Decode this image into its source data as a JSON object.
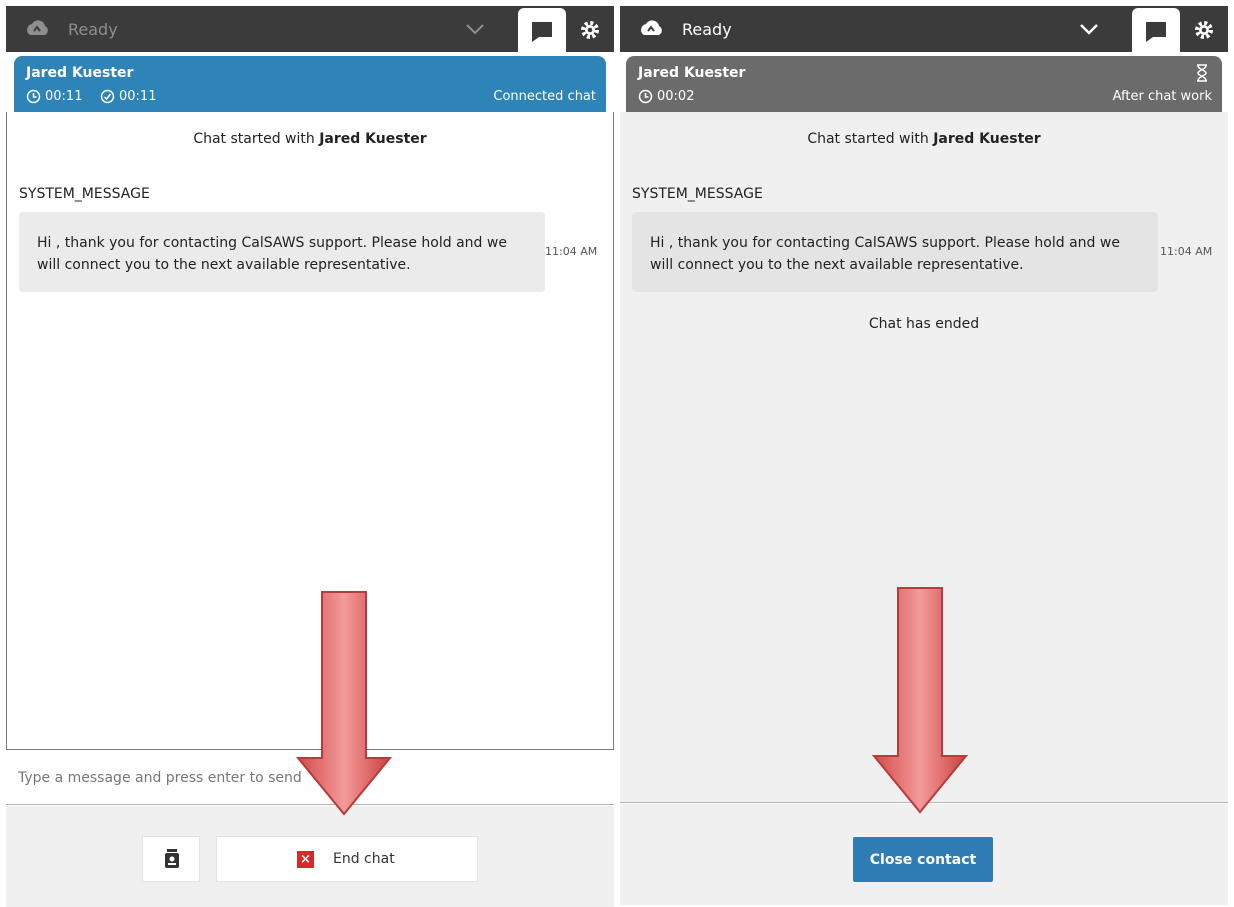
{
  "left_panel": {
    "status": "Ready",
    "contact": {
      "name": "Jared Kuester",
      "timer_total": "00:11",
      "timer_state": "00:11",
      "state": "Connected chat"
    },
    "chat": {
      "started_prefix": "Chat started with",
      "started_name": "Jared Kuester",
      "sender": "SYSTEM_MESSAGE",
      "message": "Hi , thank you for contacting CalSAWS support. Please hold and we will connect you to the next available representative.",
      "time": "11:04 AM"
    },
    "compose_placeholder": "Type a message and press enter to send",
    "end_chat_label": "End chat"
  },
  "right_panel": {
    "status": "Ready",
    "contact": {
      "name": "Jared Kuester",
      "timer_total": "00:02",
      "state": "After chat work"
    },
    "chat": {
      "started_prefix": "Chat started with",
      "started_name": "Jared Kuester",
      "sender": "SYSTEM_MESSAGE",
      "message": "Hi , thank you for contacting CalSAWS support. Please hold and we will connect you to the next available representative.",
      "time": "11:04 AM",
      "ended": "Chat has ended"
    },
    "close_contact_label": "Close contact"
  },
  "colors": {
    "topbar": "#3b3b3b",
    "connected": "#2e84b6",
    "after_chat_work": "#6b6b6b",
    "primary_button": "#2f7db4",
    "arrow": "#e06262"
  },
  "icons": [
    "cloud-status-icon",
    "chevron-down-icon",
    "chat-bubble-icon",
    "gear-icon",
    "clock-icon",
    "check-clock-icon",
    "hourglass-icon",
    "contact-card-icon",
    "close-x-icon",
    "down-arrow-annotation"
  ]
}
